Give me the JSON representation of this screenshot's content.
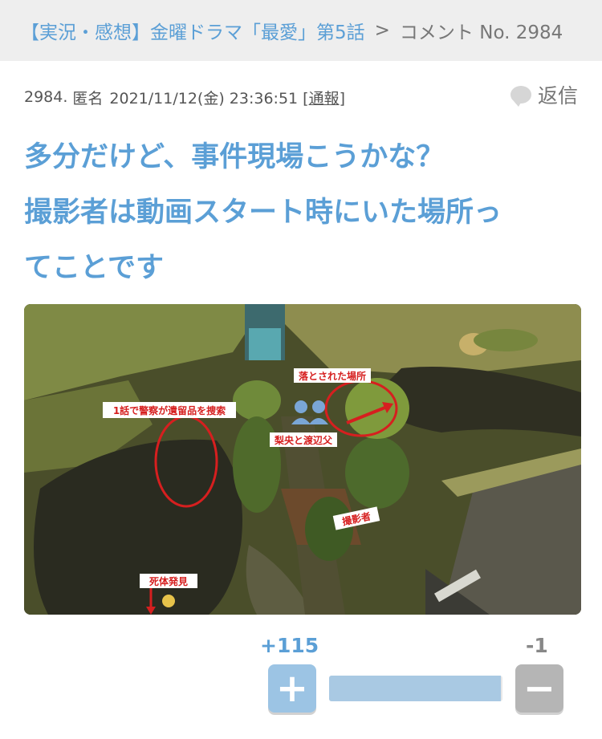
{
  "breadcrumb": {
    "thread_title": "【実況・感想】金曜ドラマ「最愛」第5話",
    "separator": ">",
    "current": "コメント No. 2984"
  },
  "comment": {
    "number": "2984.",
    "author": "匿名",
    "datetime": "2021/11/12(金) 23:36:51",
    "report_open": "[",
    "report_label": "通報",
    "report_close": "]",
    "reply_label": "返信",
    "body_lines": [
      "多分だけど、事件現場こうかな？",
      "撮影者は動画スタート時にいた場所っ",
      "てことです"
    ]
  },
  "photo": {
    "annotations": {
      "search": "1話で警察が遺留品を捜索",
      "dropped": "落とされた場所",
      "people": "梨央と渡辺父",
      "photographer": "撮影者",
      "body_found": "死体発見"
    }
  },
  "votes": {
    "plus_count": "+115",
    "minus_count": "-1",
    "plus_label": "+",
    "minus_label": "−",
    "plus_ratio": 0.991
  },
  "colors": {
    "accent": "#5b9fd6",
    "breadcrumb_bg": "#eeeeee"
  }
}
